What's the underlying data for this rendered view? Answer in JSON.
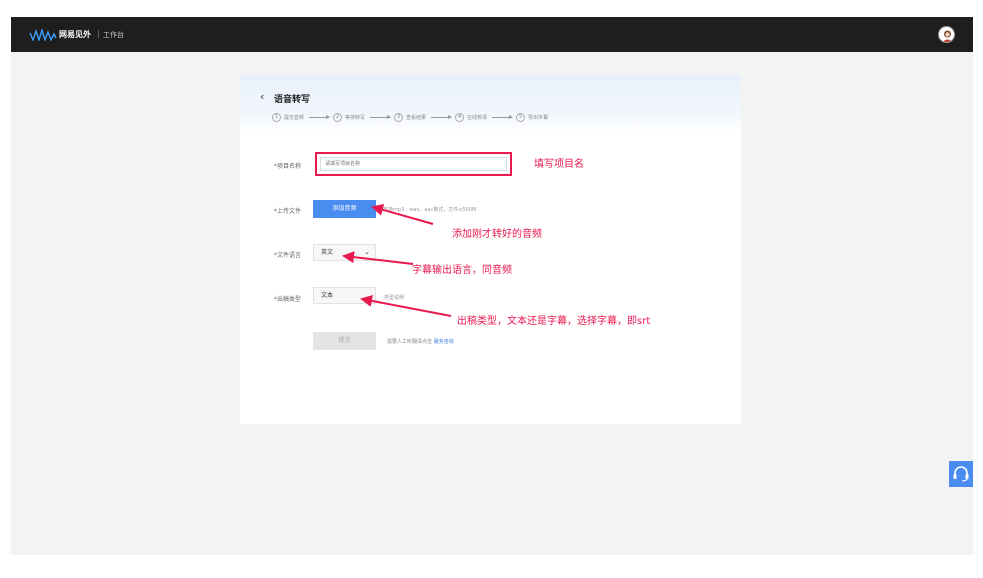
{
  "topbar": {
    "brand": "网易见外",
    "separator": "|",
    "subtitle": "工作台"
  },
  "page": {
    "title": "语音转写"
  },
  "steps": [
    {
      "num": "1",
      "label": "提交音频"
    },
    {
      "num": "2",
      "label": "等待转写"
    },
    {
      "num": "3",
      "label": "查看结果"
    },
    {
      "num": "4",
      "label": "在线校译"
    },
    {
      "num": "5",
      "label": "导出字幕"
    }
  ],
  "form": {
    "project_label": "*项目名称",
    "project_placeholder": "请填写项目名称",
    "upload_label": "*上传文件",
    "upload_button": "添加音频",
    "upload_hint": "支持mp3、wav、aac格式，文件≤500M",
    "language_label": "*文件语言",
    "language_value": "英文",
    "type_label": "*出稿类型",
    "type_value": "文本",
    "type_extra": "类型说明",
    "submit_button": "提交",
    "submit_hint": "需要人工听翻译点击",
    "submit_link": "服务咨询"
  },
  "annotations": {
    "project": "填写项目名",
    "upload": "添加刚才转好的音频",
    "language": "字幕输出语言，同音频",
    "type": "出稿类型，文本还是字幕，选择字幕，即srt"
  },
  "colors": {
    "annotation": "#e8194f",
    "primary": "#4a8cf0",
    "topbar": "#1e1e1e"
  }
}
